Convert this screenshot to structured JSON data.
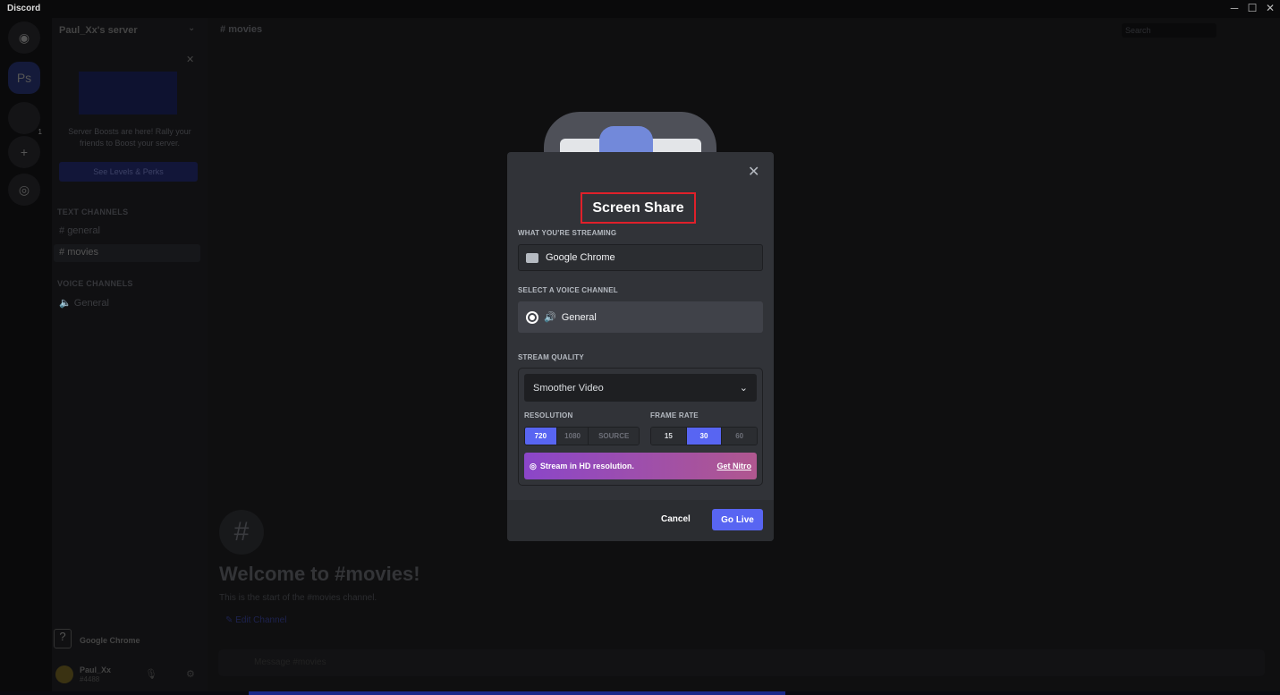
{
  "window": {
    "title": "Discord",
    "minimize": "─",
    "maximize": "☐",
    "close": "✕"
  },
  "rail": {
    "servers": [
      {
        "label": "Ps"
      },
      {
        "label": "",
        "badge": "1"
      }
    ],
    "add": "+",
    "explore": "◎"
  },
  "sidebar": {
    "server_name": "Paul_Xx's server",
    "boost_text": "Server Boosts are here! Rally your friends to Boost your server.",
    "boost_button": "See Levels & Perks",
    "text_category": "TEXT CHANNELS",
    "text_channels": [
      "general",
      "movies"
    ],
    "voice_category": "VOICE CHANNELS",
    "voice_channels": [
      "General"
    ],
    "streaming_app": "Google Chrome",
    "user": {
      "name": "Paul_Xx",
      "tag": "#4488"
    }
  },
  "header": {
    "channel": "movies",
    "search_placeholder": "Search"
  },
  "welcome": {
    "title": "Welcome to #movies!",
    "subtitle": "This is the start of the #movies channel.",
    "edit": "Edit Channel",
    "message_placeholder": "Message #movies"
  },
  "modal": {
    "title": "Screen Share",
    "streaming_label": "WHAT YOU'RE STREAMING",
    "streaming_value": "Google Chrome",
    "voice_label": "SELECT A VOICE CHANNEL",
    "voice_value": "General",
    "quality_label": "STREAM QUALITY",
    "quality_value": "Smoother Video",
    "resolution_label": "RESOLUTION",
    "resolutions": [
      "720",
      "1080",
      "SOURCE"
    ],
    "selected_resolution": "720",
    "framerate_label": "FRAME RATE",
    "framerates": [
      "15",
      "30",
      "60"
    ],
    "selected_framerate": "30",
    "nitro_text": "Stream in HD resolution.",
    "nitro_link": "Get Nitro",
    "cancel": "Cancel",
    "go_live": "Go Live",
    "accent": "#5865f2",
    "highlight": "#e0202a"
  }
}
